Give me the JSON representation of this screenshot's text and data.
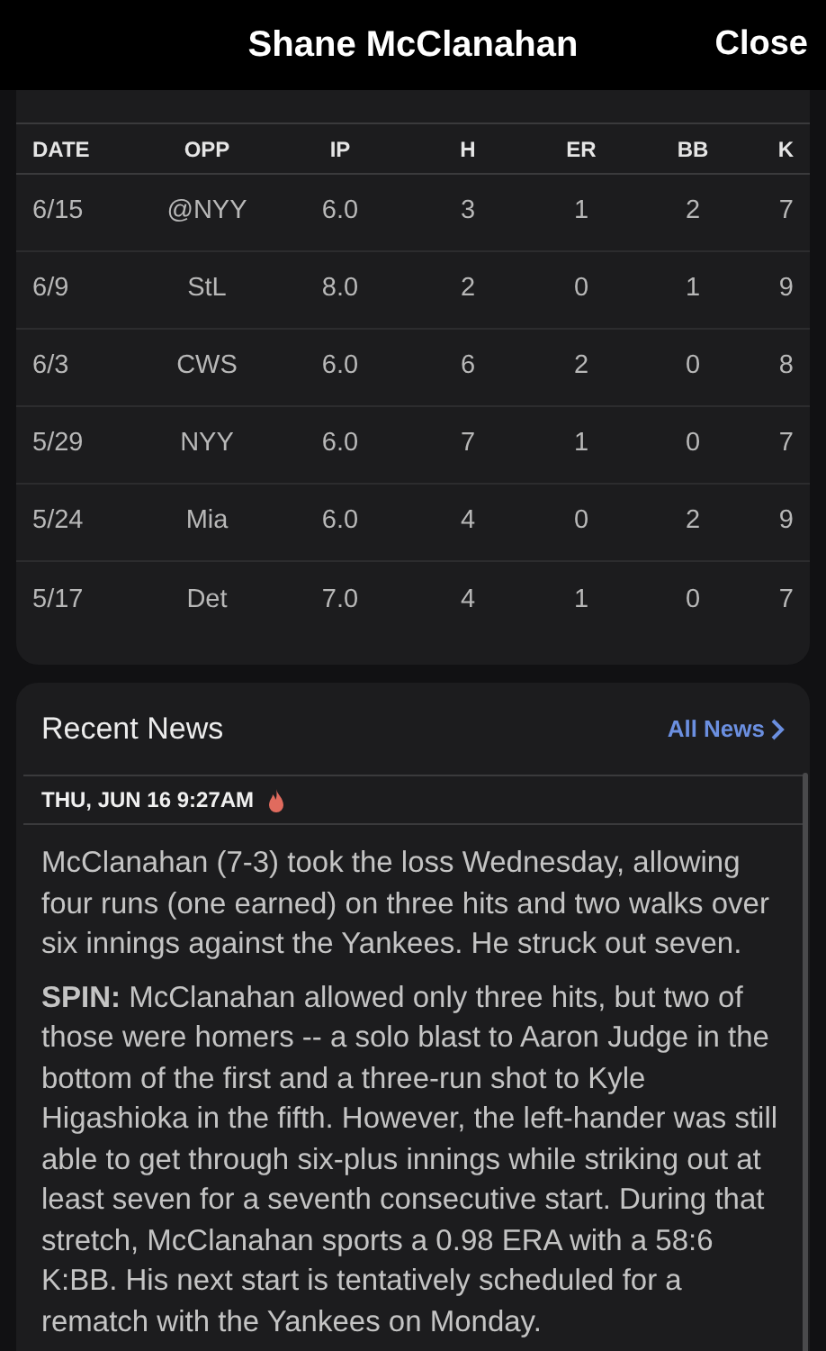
{
  "header": {
    "title": "Shane McClanahan",
    "close": "Close"
  },
  "game_log": {
    "columns": [
      "DATE",
      "OPP",
      "IP",
      "H",
      "ER",
      "BB",
      "K"
    ],
    "rows": [
      [
        "6/15",
        "@NYY",
        "6.0",
        "3",
        "1",
        "2",
        "7"
      ],
      [
        "6/9",
        "StL",
        "8.0",
        "2",
        "0",
        "1",
        "9"
      ],
      [
        "6/3",
        "CWS",
        "6.0",
        "6",
        "2",
        "0",
        "8"
      ],
      [
        "5/29",
        "NYY",
        "6.0",
        "7",
        "1",
        "0",
        "7"
      ],
      [
        "5/24",
        "Mia",
        "6.0",
        "4",
        "0",
        "2",
        "9"
      ],
      [
        "5/17",
        "Det",
        "7.0",
        "4",
        "1",
        "0",
        "7"
      ]
    ]
  },
  "news": {
    "title": "Recent News",
    "link": "All News",
    "date": "THU, JUN 16 9:27AM",
    "hot": true,
    "summary": "McClanahan (7-3) took the loss Wednesday, allowing four runs (one earned) on three hits and two walks over six innings against the Yankees. He struck out seven.",
    "spin": "**SPIN:**  McClanahan allowed only three hits, but two of those were homers -- a solo blast to Aaron Judge in the bottom of the first and a three-run shot to Kyle Higashioka in the fifth. However, the left-hander was still able to get through six-plus innings while striking out at least seven for a seventh consecutive start. During that stretch, McClanahan sports a 0.98 ERA with a 58:6 K:BB. His next start is tentatively scheduled for a rematch with the Yankees on Monday."
  }
}
